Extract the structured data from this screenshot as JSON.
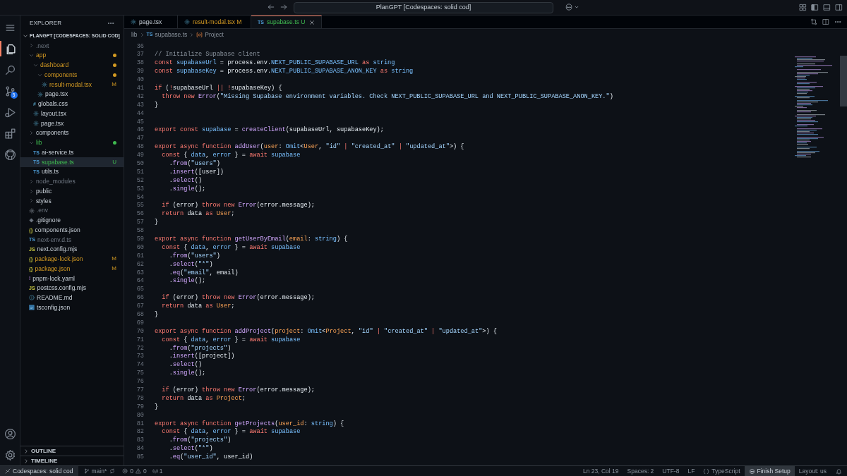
{
  "title_bar": {
    "command_center": "PlanGPT [Codespaces: solid cod]"
  },
  "activity_bar": {
    "items": [
      {
        "kind": "menu",
        "selected": false
      },
      {
        "kind": "explorer",
        "selected": true
      },
      {
        "kind": "search",
        "selected": false
      },
      {
        "kind": "source_control",
        "selected": false,
        "badge": "5"
      },
      {
        "kind": "run_debug",
        "selected": false
      },
      {
        "kind": "extensions",
        "selected": false
      },
      {
        "kind": "github",
        "selected": false
      }
    ],
    "bottom": [
      {
        "kind": "account"
      },
      {
        "kind": "settings"
      }
    ]
  },
  "sidebar": {
    "title": "EXPLORER",
    "root": {
      "label": "PLANGPT [CODESPACES: SOLID COD]",
      "expanded": true,
      "items": [
        {
          "name": ".next",
          "kind": "folder",
          "expanded": false,
          "modified": false,
          "untracked": false,
          "ignored": true
        },
        {
          "name": "app",
          "kind": "folder",
          "expanded": true,
          "modified": true,
          "untracked": false,
          "ignored": false,
          "dot": true,
          "children": [
            {
              "name": "dashboard",
              "kind": "folder",
              "expanded": true,
              "modified": true,
              "untracked": false,
              "ignored": false,
              "dot": true,
              "children": [
                {
                  "name": "components",
                  "kind": "folder",
                  "expanded": true,
                  "modified": true,
                  "untracked": false,
                  "ignored": false,
                  "dot": true,
                  "children": [
                    {
                      "name": "result-modal.tsx",
                      "kind": "tsx",
                      "modified": true,
                      "untracked": false,
                      "ignored": false,
                      "badge": "M",
                      "selected": false
                    }
                  ]
                },
                {
                  "name": "page.tsx",
                  "kind": "tsx",
                  "modified": false,
                  "untracked": false,
                  "ignored": false,
                  "selected": false
                }
              ]
            },
            {
              "name": "globals.css",
              "kind": "css",
              "glyph": "#",
              "modified": false,
              "untracked": false,
              "ignored": false,
              "selected": false
            },
            {
              "name": "layout.tsx",
              "kind": "tsx",
              "modified": false,
              "untracked": false,
              "ignored": false,
              "selected": false
            },
            {
              "name": "page.tsx",
              "kind": "tsx",
              "modified": false,
              "untracked": false,
              "ignored": false,
              "selected": false
            }
          ]
        },
        {
          "name": "components",
          "kind": "folder",
          "expanded": false,
          "modified": false,
          "untracked": false,
          "ignored": false
        },
        {
          "name": "lib",
          "kind": "folder",
          "expanded": true,
          "modified": false,
          "untracked": true,
          "ignored": false,
          "dot": true,
          "children": [
            {
              "name": "ai-service.ts",
              "kind": "ts",
              "glyph": "TS",
              "modified": false,
              "untracked": false,
              "ignored": false,
              "selected": false
            },
            {
              "name": "supabase.ts",
              "kind": "ts",
              "glyph": "TS",
              "modified": false,
              "untracked": true,
              "ignored": false,
              "badge": "U",
              "selected": true
            },
            {
              "name": "utils.ts",
              "kind": "ts",
              "glyph": "TS",
              "modified": false,
              "untracked": false,
              "ignored": false,
              "selected": false
            }
          ]
        },
        {
          "name": "node_modules",
          "kind": "folder",
          "expanded": false,
          "modified": false,
          "untracked": false,
          "ignored": true
        },
        {
          "name": "public",
          "kind": "folder",
          "expanded": false,
          "modified": false,
          "untracked": false,
          "ignored": false
        },
        {
          "name": "styles",
          "kind": "folder",
          "expanded": false,
          "modified": false,
          "untracked": false,
          "ignored": false
        },
        {
          "name": ".env",
          "kind": "env",
          "modified": false,
          "untracked": false,
          "ignored": true,
          "selected": false
        },
        {
          "name": ".gitignore",
          "kind": "git",
          "modified": false,
          "untracked": false,
          "ignored": false,
          "selected": false
        },
        {
          "name": "components.json",
          "kind": "json",
          "glyph": "{}",
          "modified": false,
          "untracked": false,
          "ignored": false,
          "selected": false
        },
        {
          "name": "next-env.d.ts",
          "kind": "ts",
          "glyph": "TS",
          "modified": false,
          "untracked": false,
          "ignored": true,
          "selected": false
        },
        {
          "name": "next.config.mjs",
          "kind": "js",
          "glyph": "JS",
          "modified": false,
          "untracked": false,
          "ignored": false,
          "selected": false
        },
        {
          "name": "package-lock.json",
          "kind": "json",
          "glyph": "{}",
          "modified": true,
          "untracked": false,
          "ignored": false,
          "badge": "M",
          "selected": false
        },
        {
          "name": "package.json",
          "kind": "json",
          "glyph": "{}",
          "modified": true,
          "untracked": false,
          "ignored": false,
          "badge": "M",
          "selected": false
        },
        {
          "name": "pnpm-lock.yaml",
          "kind": "yaml",
          "glyph": "!",
          "modified": false,
          "untracked": false,
          "ignored": false,
          "selected": false
        },
        {
          "name": "postcss.config.mjs",
          "kind": "js",
          "glyph": "JS",
          "modified": false,
          "untracked": false,
          "ignored": false,
          "selected": false
        },
        {
          "name": "README.md",
          "kind": "info",
          "modified": false,
          "untracked": false,
          "ignored": false,
          "selected": false
        },
        {
          "name": "tsconfig.json",
          "kind": "tsconfig",
          "modified": false,
          "untracked": false,
          "ignored": false,
          "selected": false
        }
      ]
    },
    "sections": [
      {
        "label": "OUTLINE",
        "expanded": false
      },
      {
        "label": "TIMELINE",
        "expanded": false
      }
    ]
  },
  "tabs": [
    {
      "label": "page.tsx",
      "kind": "tsx",
      "modified": false,
      "untracked": false,
      "selected": false
    },
    {
      "label": "result-modal.tsx M",
      "kind": "tsx",
      "modified": true,
      "untracked": false,
      "selected": false
    },
    {
      "label": "supabase.ts U",
      "kind": "ts",
      "glyph": "TS",
      "modified": false,
      "untracked": true,
      "selected": true
    }
  ],
  "breadcrumb": [
    {
      "kind": "folder",
      "label": "lib"
    },
    {
      "kind": "file",
      "glyph": "TS",
      "label": "supabase.ts"
    },
    {
      "kind": "symbol",
      "label": "Project"
    }
  ],
  "editor": {
    "lines": [
      {
        "number": "36"
      },
      {
        "number": "37",
        "tokens": [
          {
            "kind": "comment",
            "text": "// Initialize Supabase client"
          }
        ]
      },
      {
        "number": "38",
        "tokens": [
          {
            "kind": "keyword",
            "text": "const"
          },
          {
            "kind": "variable",
            "text": " supabaseUrl"
          },
          {
            "kind": "plain",
            "text": " = process.env."
          },
          {
            "kind": "variable",
            "text": "NEXT_PUBLIC_SUPABASE_URL"
          },
          {
            "kind": "keyword",
            "text": " as"
          },
          {
            "kind": "variable",
            "text": " string"
          }
        ]
      },
      {
        "number": "39",
        "tokens": [
          {
            "kind": "keyword",
            "text": "const"
          },
          {
            "kind": "variable",
            "text": " supabaseKey"
          },
          {
            "kind": "plain",
            "text": " = process.env."
          },
          {
            "kind": "variable",
            "text": "NEXT_PUBLIC_SUPABASE_ANON_KEY"
          },
          {
            "kind": "keyword",
            "text": " as"
          },
          {
            "kind": "variable",
            "text": " string"
          }
        ]
      },
      {
        "number": "40"
      },
      {
        "number": "41",
        "tokens": [
          {
            "kind": "keyword",
            "text": "if"
          },
          {
            "kind": "plain",
            "text": " ("
          },
          {
            "kind": "keyword",
            "text": "!"
          },
          {
            "kind": "plain",
            "text": "supabaseUrl "
          },
          {
            "kind": "keyword",
            "text": "||"
          },
          {
            "kind": "keyword",
            "text": " !"
          },
          {
            "kind": "plain",
            "text": "supabaseKey) {"
          }
        ]
      },
      {
        "number": "42",
        "tokens": [
          {
            "kind": "keyword",
            "text": "  throw new"
          },
          {
            "kind": "function",
            "text": " Error"
          },
          {
            "kind": "plain",
            "text": "("
          },
          {
            "kind": "string",
            "text": "\"Missing Supabase environment variables. Check NEXT_PUBLIC_SUPABASE_URL and NEXT_PUBLIC_SUPABASE_ANON_KEY.\""
          },
          {
            "kind": "plain",
            "text": ")"
          }
        ]
      },
      {
        "number": "43",
        "tokens": [
          {
            "kind": "plain",
            "text": "}"
          }
        ]
      },
      {
        "number": "44"
      },
      {
        "number": "45"
      },
      {
        "number": "46",
        "tokens": [
          {
            "kind": "keyword",
            "text": "export const"
          },
          {
            "kind": "variable",
            "text": " supabase"
          },
          {
            "kind": "plain",
            "text": " = "
          },
          {
            "kind": "function",
            "text": "createClient"
          },
          {
            "kind": "plain",
            "text": "(supabaseUrl, supabaseKey);"
          }
        ]
      },
      {
        "number": "47"
      },
      {
        "number": "48",
        "tokens": [
          {
            "kind": "keyword",
            "text": "export async function"
          },
          {
            "kind": "function",
            "text": " addUser"
          },
          {
            "kind": "plain",
            "text": "("
          },
          {
            "kind": "type",
            "text": "user"
          },
          {
            "kind": "plain",
            "text": ": "
          },
          {
            "kind": "variable",
            "text": "Omit"
          },
          {
            "kind": "plain",
            "text": "<"
          },
          {
            "kind": "type",
            "text": "User"
          },
          {
            "kind": "plain",
            "text": ", "
          },
          {
            "kind": "string",
            "text": "\"id\""
          },
          {
            "kind": "keyword",
            "text": " |"
          },
          {
            "kind": "string",
            "text": " \"created_at\""
          },
          {
            "kind": "keyword",
            "text": " |"
          },
          {
            "kind": "string",
            "text": " \"updated_at\""
          },
          {
            "kind": "plain",
            "text": ">) {"
          }
        ]
      },
      {
        "number": "49",
        "tokens": [
          {
            "kind": "keyword",
            "text": "  const"
          },
          {
            "kind": "plain",
            "text": " { "
          },
          {
            "kind": "variable",
            "text": "data"
          },
          {
            "kind": "plain",
            "text": ", "
          },
          {
            "kind": "variable",
            "text": "error"
          },
          {
            "kind": "plain",
            "text": " } = "
          },
          {
            "kind": "keyword",
            "text": "await"
          },
          {
            "kind": "variable",
            "text": " supabase"
          }
        ]
      },
      {
        "number": "50",
        "tokens": [
          {
            "kind": "plain",
            "text": "    ."
          },
          {
            "kind": "function",
            "text": "from"
          },
          {
            "kind": "plain",
            "text": "("
          },
          {
            "kind": "string",
            "text": "\"users\""
          },
          {
            "kind": "plain",
            "text": ")"
          }
        ]
      },
      {
        "number": "51",
        "tokens": [
          {
            "kind": "plain",
            "text": "    ."
          },
          {
            "kind": "function",
            "text": "insert"
          },
          {
            "kind": "plain",
            "text": "([user])"
          }
        ]
      },
      {
        "number": "52",
        "tokens": [
          {
            "kind": "plain",
            "text": "    ."
          },
          {
            "kind": "function",
            "text": "select"
          },
          {
            "kind": "plain",
            "text": "()"
          }
        ]
      },
      {
        "number": "53",
        "tokens": [
          {
            "kind": "plain",
            "text": "    ."
          },
          {
            "kind": "function",
            "text": "single"
          },
          {
            "kind": "plain",
            "text": "();"
          }
        ]
      },
      {
        "number": "54"
      },
      {
        "number": "55",
        "tokens": [
          {
            "kind": "keyword",
            "text": "  if"
          },
          {
            "kind": "plain",
            "text": " (error) "
          },
          {
            "kind": "keyword",
            "text": "throw new"
          },
          {
            "kind": "function",
            "text": " Error"
          },
          {
            "kind": "plain",
            "text": "(error.message);"
          }
        ]
      },
      {
        "number": "56",
        "tokens": [
          {
            "kind": "keyword",
            "text": "  return"
          },
          {
            "kind": "plain",
            "text": " data "
          },
          {
            "kind": "keyword",
            "text": "as"
          },
          {
            "kind": "type",
            "text": " User"
          },
          {
            "kind": "plain",
            "text": ";"
          }
        ]
      },
      {
        "number": "57",
        "tokens": [
          {
            "kind": "plain",
            "text": "}"
          }
        ]
      },
      {
        "number": "58"
      },
      {
        "number": "59",
        "tokens": [
          {
            "kind": "keyword",
            "text": "export async function"
          },
          {
            "kind": "function",
            "text": " getUserByEmail"
          },
          {
            "kind": "plain",
            "text": "("
          },
          {
            "kind": "type",
            "text": "email"
          },
          {
            "kind": "plain",
            "text": ": "
          },
          {
            "kind": "variable",
            "text": "string"
          },
          {
            "kind": "plain",
            "text": ") {"
          }
        ]
      },
      {
        "number": "60",
        "tokens": [
          {
            "kind": "keyword",
            "text": "  const"
          },
          {
            "kind": "plain",
            "text": " { "
          },
          {
            "kind": "variable",
            "text": "data"
          },
          {
            "kind": "plain",
            "text": ", "
          },
          {
            "kind": "variable",
            "text": "error"
          },
          {
            "kind": "plain",
            "text": " } = "
          },
          {
            "kind": "keyword",
            "text": "await"
          },
          {
            "kind": "variable",
            "text": " supabase"
          }
        ]
      },
      {
        "number": "61",
        "tokens": [
          {
            "kind": "plain",
            "text": "    ."
          },
          {
            "kind": "function",
            "text": "from"
          },
          {
            "kind": "plain",
            "text": "("
          },
          {
            "kind": "string",
            "text": "\"users\""
          },
          {
            "kind": "plain",
            "text": ")"
          }
        ]
      },
      {
        "number": "62",
        "tokens": [
          {
            "kind": "plain",
            "text": "    ."
          },
          {
            "kind": "function",
            "text": "select"
          },
          {
            "kind": "plain",
            "text": "("
          },
          {
            "kind": "string",
            "text": "\"*\""
          },
          {
            "kind": "plain",
            "text": ")"
          }
        ]
      },
      {
        "number": "63",
        "tokens": [
          {
            "kind": "plain",
            "text": "    ."
          },
          {
            "kind": "function",
            "text": "eq"
          },
          {
            "kind": "plain",
            "text": "("
          },
          {
            "kind": "string",
            "text": "\"email\""
          },
          {
            "kind": "plain",
            "text": ", email)"
          }
        ]
      },
      {
        "number": "64",
        "tokens": [
          {
            "kind": "plain",
            "text": "    ."
          },
          {
            "kind": "function",
            "text": "single"
          },
          {
            "kind": "plain",
            "text": "();"
          }
        ]
      },
      {
        "number": "65"
      },
      {
        "number": "66",
        "tokens": [
          {
            "kind": "keyword",
            "text": "  if"
          },
          {
            "kind": "plain",
            "text": " (error) "
          },
          {
            "kind": "keyword",
            "text": "throw new"
          },
          {
            "kind": "function",
            "text": " Error"
          },
          {
            "kind": "plain",
            "text": "(error.message);"
          }
        ]
      },
      {
        "number": "67",
        "tokens": [
          {
            "kind": "keyword",
            "text": "  return"
          },
          {
            "kind": "plain",
            "text": " data "
          },
          {
            "kind": "keyword",
            "text": "as"
          },
          {
            "kind": "type",
            "text": " User"
          },
          {
            "kind": "plain",
            "text": ";"
          }
        ]
      },
      {
        "number": "68",
        "tokens": [
          {
            "kind": "plain",
            "text": "}"
          }
        ]
      },
      {
        "number": "69"
      },
      {
        "number": "70",
        "tokens": [
          {
            "kind": "keyword",
            "text": "export async function"
          },
          {
            "kind": "function",
            "text": " addProject"
          },
          {
            "kind": "plain",
            "text": "("
          },
          {
            "kind": "type",
            "text": "project"
          },
          {
            "kind": "plain",
            "text": ": "
          },
          {
            "kind": "variable",
            "text": "Omit"
          },
          {
            "kind": "plain",
            "text": "<"
          },
          {
            "kind": "type",
            "text": "Project"
          },
          {
            "kind": "plain",
            "text": ", "
          },
          {
            "kind": "string",
            "text": "\"id\""
          },
          {
            "kind": "keyword",
            "text": " |"
          },
          {
            "kind": "string",
            "text": " \"created_at\""
          },
          {
            "kind": "keyword",
            "text": " |"
          },
          {
            "kind": "string",
            "text": " \"updated_at\""
          },
          {
            "kind": "plain",
            "text": ">) {"
          }
        ]
      },
      {
        "number": "71",
        "tokens": [
          {
            "kind": "keyword",
            "text": "  const"
          },
          {
            "kind": "plain",
            "text": " { "
          },
          {
            "kind": "variable",
            "text": "data"
          },
          {
            "kind": "plain",
            "text": ", "
          },
          {
            "kind": "variable",
            "text": "error"
          },
          {
            "kind": "plain",
            "text": " } = "
          },
          {
            "kind": "keyword",
            "text": "await"
          },
          {
            "kind": "variable",
            "text": " supabase"
          }
        ]
      },
      {
        "number": "72",
        "tokens": [
          {
            "kind": "plain",
            "text": "    ."
          },
          {
            "kind": "function",
            "text": "from"
          },
          {
            "kind": "plain",
            "text": "("
          },
          {
            "kind": "string",
            "text": "\"projects\""
          },
          {
            "kind": "plain",
            "text": ")"
          }
        ]
      },
      {
        "number": "73",
        "tokens": [
          {
            "kind": "plain",
            "text": "    ."
          },
          {
            "kind": "function",
            "text": "insert"
          },
          {
            "kind": "plain",
            "text": "([project])"
          }
        ]
      },
      {
        "number": "74",
        "tokens": [
          {
            "kind": "plain",
            "text": "    ."
          },
          {
            "kind": "function",
            "text": "select"
          },
          {
            "kind": "plain",
            "text": "()"
          }
        ]
      },
      {
        "number": "75",
        "tokens": [
          {
            "kind": "plain",
            "text": "    ."
          },
          {
            "kind": "function",
            "text": "single"
          },
          {
            "kind": "plain",
            "text": "();"
          }
        ]
      },
      {
        "number": "76"
      },
      {
        "number": "77",
        "tokens": [
          {
            "kind": "keyword",
            "text": "  if"
          },
          {
            "kind": "plain",
            "text": " (error) "
          },
          {
            "kind": "keyword",
            "text": "throw new"
          },
          {
            "kind": "function",
            "text": " Error"
          },
          {
            "kind": "plain",
            "text": "(error.message);"
          }
        ]
      },
      {
        "number": "78",
        "tokens": [
          {
            "kind": "keyword",
            "text": "  return"
          },
          {
            "kind": "plain",
            "text": " data "
          },
          {
            "kind": "keyword",
            "text": "as"
          },
          {
            "kind": "type",
            "text": " Project"
          },
          {
            "kind": "plain",
            "text": ";"
          }
        ]
      },
      {
        "number": "79",
        "tokens": [
          {
            "kind": "plain",
            "text": "}"
          }
        ]
      },
      {
        "number": "80"
      },
      {
        "number": "81",
        "tokens": [
          {
            "kind": "keyword",
            "text": "export async function"
          },
          {
            "kind": "function",
            "text": " getProjects"
          },
          {
            "kind": "plain",
            "text": "("
          },
          {
            "kind": "type",
            "text": "user_id"
          },
          {
            "kind": "plain",
            "text": ": "
          },
          {
            "kind": "variable",
            "text": "string"
          },
          {
            "kind": "plain",
            "text": ") {"
          }
        ]
      },
      {
        "number": "82",
        "tokens": [
          {
            "kind": "keyword",
            "text": "  const"
          },
          {
            "kind": "plain",
            "text": " { "
          },
          {
            "kind": "variable",
            "text": "data"
          },
          {
            "kind": "plain",
            "text": ", "
          },
          {
            "kind": "variable",
            "text": "error"
          },
          {
            "kind": "plain",
            "text": " } = "
          },
          {
            "kind": "keyword",
            "text": "await"
          },
          {
            "kind": "variable",
            "text": " supabase"
          }
        ]
      },
      {
        "number": "83",
        "tokens": [
          {
            "kind": "plain",
            "text": "    ."
          },
          {
            "kind": "function",
            "text": "from"
          },
          {
            "kind": "plain",
            "text": "("
          },
          {
            "kind": "string",
            "text": "\"projects\""
          },
          {
            "kind": "plain",
            "text": ")"
          }
        ]
      },
      {
        "number": "84",
        "tokens": [
          {
            "kind": "plain",
            "text": "    ."
          },
          {
            "kind": "function",
            "text": "select"
          },
          {
            "kind": "plain",
            "text": "("
          },
          {
            "kind": "string",
            "text": "\"*\""
          },
          {
            "kind": "plain",
            "text": ")"
          }
        ]
      },
      {
        "number": "85",
        "tokens": [
          {
            "kind": "plain",
            "text": "    ."
          },
          {
            "kind": "function",
            "text": "eq"
          },
          {
            "kind": "plain",
            "text": "("
          },
          {
            "kind": "string",
            "text": "\"user_id\""
          },
          {
            "kind": "plain",
            "text": ", user_id)"
          }
        ]
      }
    ]
  },
  "status_bar": {
    "remote": "Codespaces: solid cod",
    "branch": "main*",
    "errors": "0",
    "warnings": "0",
    "ports": "1",
    "right": [
      {
        "kind": "text",
        "label": "Ln 23, Col 19",
        "highlighted": false
      },
      {
        "kind": "text",
        "label": "Spaces: 2",
        "highlighted": false
      },
      {
        "kind": "text",
        "label": "UTF-8",
        "highlighted": false
      },
      {
        "kind": "text",
        "label": "LF",
        "highlighted": false
      },
      {
        "kind": "language",
        "label": "TypeScript",
        "highlighted": false
      },
      {
        "kind": "copilot",
        "label": "Finish Setup",
        "highlighted": true
      },
      {
        "kind": "text",
        "label": "Layout: us",
        "highlighted": false
      }
    ]
  }
}
